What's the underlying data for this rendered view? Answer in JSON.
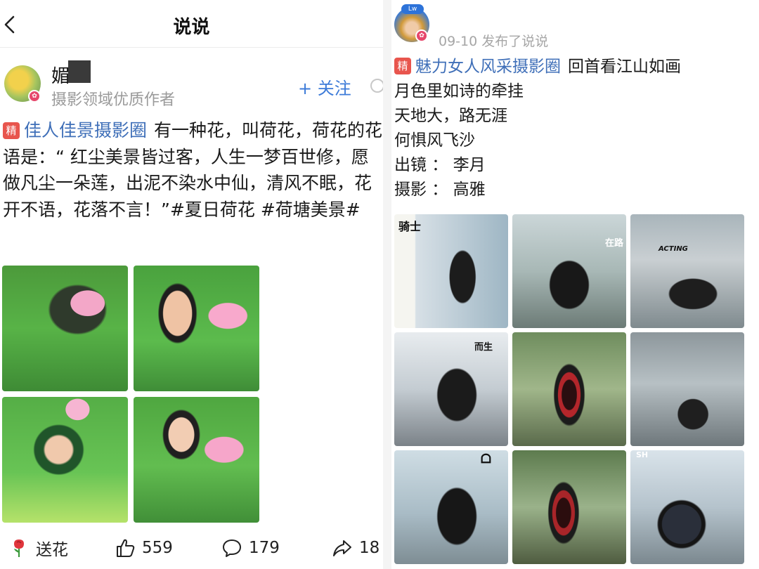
{
  "left_post": {
    "nav": {
      "title": "说说"
    },
    "author": {
      "name": "媚",
      "subtitle": "摄影领域优质作者",
      "follow_label": "+ 关注",
      "vip_mark": "✿"
    },
    "post": {
      "badge": "精",
      "circle": "佳人佳景摄影圈",
      "text": "有一种花，叫荷花，荷花的花语是：“ 红尘美景皆过客，人生一梦百世修，愿做凡尘一朵莲，出泥不染水中仙，清风不眠，花开不语，花落不言！”#夏日荷花 #荷塘美景#"
    },
    "photos": [
      {
        "name": "lotus-photo-1"
      },
      {
        "name": "lotus-photo-2"
      },
      {
        "name": "lotus-photo-3"
      },
      {
        "name": "lotus-photo-4"
      }
    ],
    "actions": {
      "flower_label": "送花",
      "likes": "559",
      "comments": "179",
      "shares": "18"
    },
    "icons": [
      "back-icon",
      "rose-icon",
      "thumbs-up-icon",
      "comment-icon",
      "share-icon"
    ]
  },
  "right_post": {
    "avatar_tag": "Lw",
    "date_line": "09-10 发布了说说",
    "post": {
      "badge": "精",
      "circle": "魅力女人风采摄影圈",
      "first_line_text": "回首看江山如画",
      "lines": [
        "月色里如诗的牵挂",
        "天地大，路无涯",
        "何惧风飞沙",
        "出镜 ： 李月",
        "摄影 ： 高雅"
      ]
    },
    "photo_captions": [
      "骑士",
      "在路",
      "ACTING",
      "而生",
      "ᗝ",
      "SH"
    ]
  },
  "colors": {
    "link_blue": "#3f6fb8",
    "follow_blue": "#3d7bd8",
    "badge_red": "#e8554d",
    "vip_pink": "#e6476b",
    "muted_gray": "#9a9a9a"
  }
}
